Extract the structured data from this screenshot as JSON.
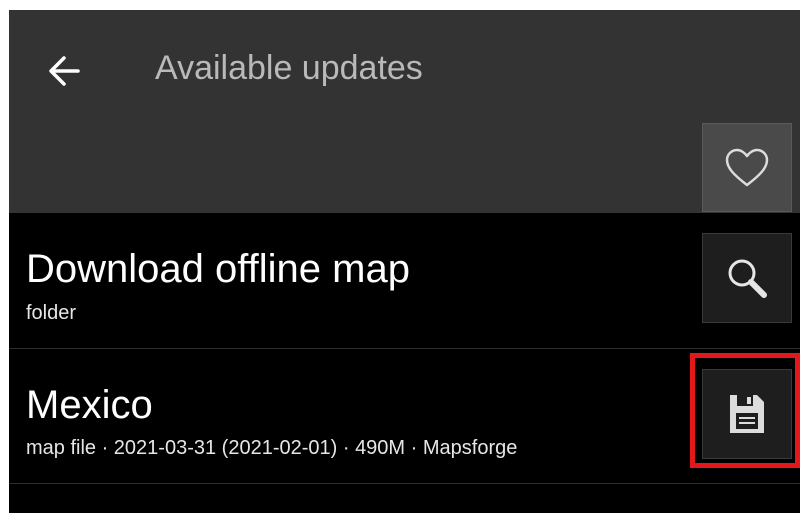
{
  "appbar": {
    "title": "Available updates",
    "back_icon": "arrow-left-icon",
    "favorite_icon": "heart-outline-icon"
  },
  "rows": [
    {
      "title": "Download offline map",
      "subtitle": "folder",
      "action_icon": "search-icon"
    },
    {
      "title": "Mexico",
      "subtitle": "map file · 2021-03-31 (2021-02-01) · 490M · Mapsforge",
      "action_icon": "save-floppy-icon",
      "highlighted": true
    }
  ],
  "colors": {
    "appbar_bg": "#333333",
    "list_bg": "#000000",
    "title_text": "#b9b9b9",
    "highlight": "#e4171b"
  }
}
